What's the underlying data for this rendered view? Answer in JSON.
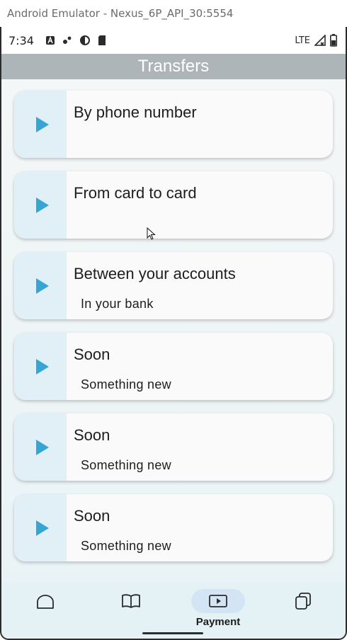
{
  "emulator": {
    "window_title": "Android Emulator - Nexus_6P_API_30:5554"
  },
  "status_bar": {
    "time": "7:34",
    "network": "LTE"
  },
  "app_bar": {
    "title": "Transfers"
  },
  "cards": [
    {
      "title": "By phone number",
      "subtitle": ""
    },
    {
      "title": "From card to card",
      "subtitle": ""
    },
    {
      "title": "Between your accounts",
      "subtitle": "In your bank"
    },
    {
      "title": "Soon",
      "subtitle": "Something new"
    },
    {
      "title": "Soon",
      "subtitle": "Something new"
    },
    {
      "title": "Soon",
      "subtitle": "Something new"
    }
  ],
  "bottom_nav": {
    "items": [
      {
        "icon": "home-icon",
        "label": ""
      },
      {
        "icon": "book-icon",
        "label": ""
      },
      {
        "icon": "payment-icon",
        "label": "Payment",
        "active": true
      },
      {
        "icon": "cards-icon",
        "label": ""
      }
    ]
  },
  "colors": {
    "app_bar": "#adb5b9",
    "accent": "#35a6d4",
    "card_side": "#e1f0f7",
    "active_pill": "#d3e4f5"
  }
}
